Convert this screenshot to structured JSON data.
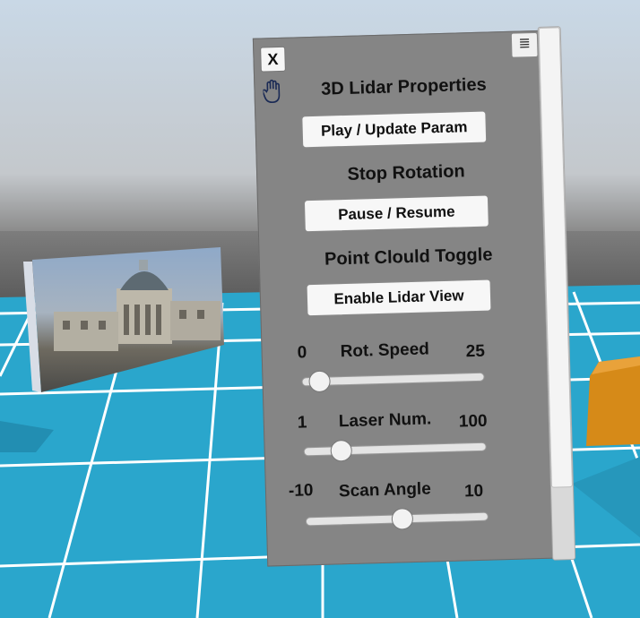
{
  "panel": {
    "close_label": "X",
    "menu_icon": "menu-icon",
    "hand_icon": "hand-icon",
    "title": "3D Lidar Properties",
    "play_button": "Play / Update Param",
    "stop_label": "Stop Rotation",
    "pause_button": "Pause / Resume",
    "cloud_label": "Point Clould Toggle",
    "lidar_button": "Enable Lidar View",
    "rot_speed": {
      "label": "Rot. Speed",
      "min": "0",
      "max": "25",
      "value": 1
    },
    "laser_num": {
      "label": "Laser Num.",
      "min": "1",
      "max": "100",
      "value": 17
    },
    "scan_angle": {
      "label": "Scan Angle",
      "min": "-10",
      "max": "10",
      "value": 0.5
    }
  },
  "colors": {
    "sky": "#ffffff",
    "horizon": "#5c5c5c",
    "floor": "#2aa6cc",
    "grid_lines": "#ffffff",
    "panel": "#858585",
    "orange_cube": "#d68a18"
  }
}
